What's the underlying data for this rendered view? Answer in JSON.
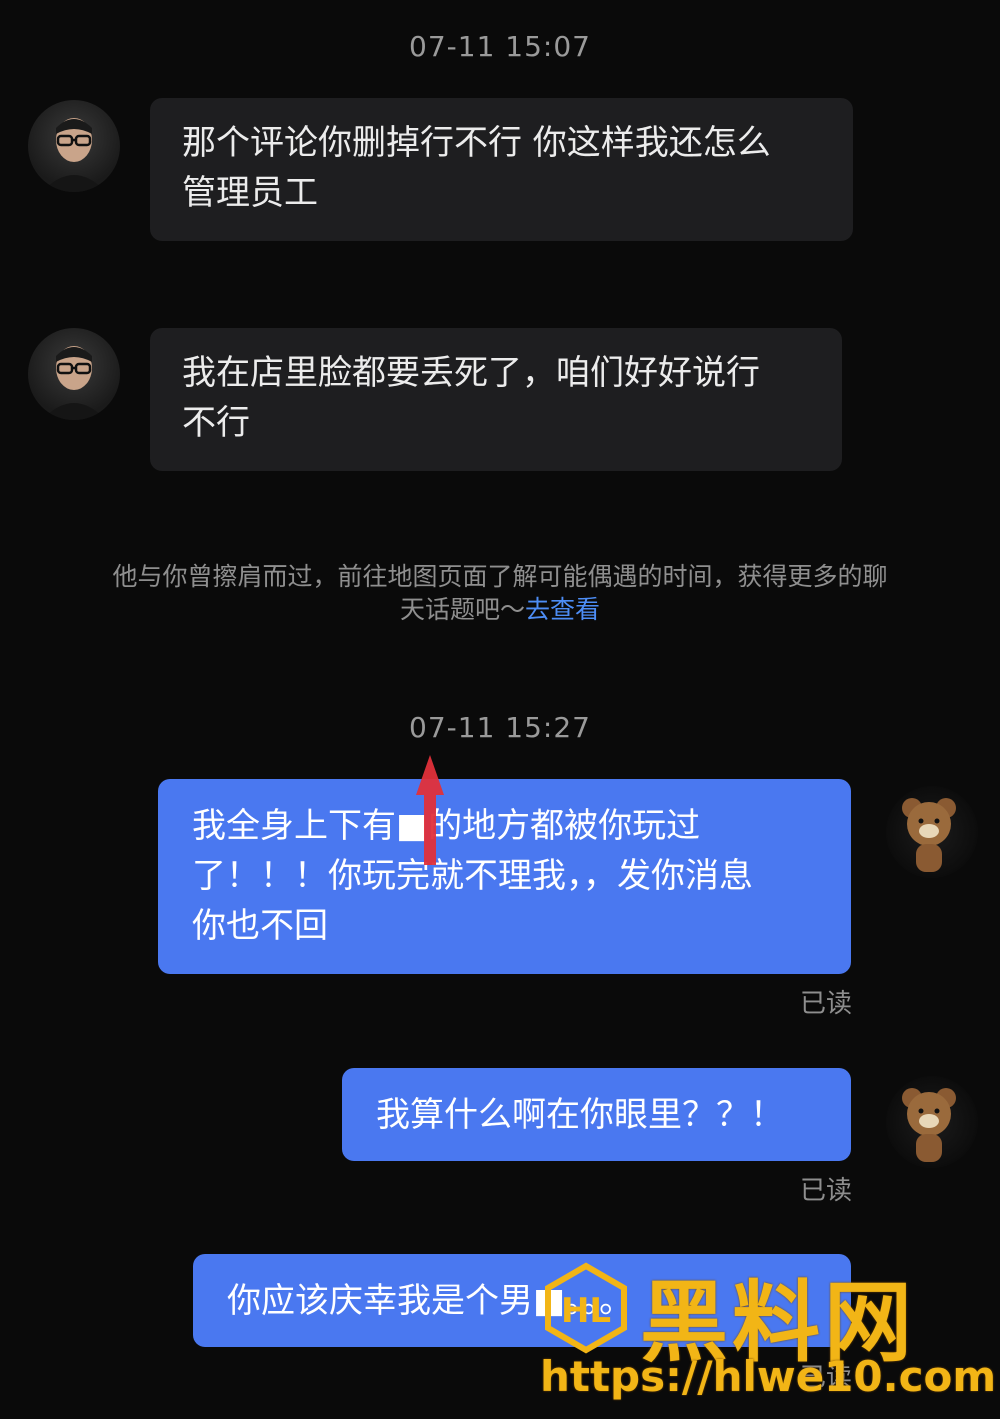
{
  "timestamps": [
    "07-11 15:07",
    "07-11 15:27"
  ],
  "messages_in": [
    "那个评论你删掉行不行 你这样我还怎么\n管理员工",
    "我在店里脸都要丢死了，咱们好好说行\n不行"
  ],
  "hint": {
    "text": "他与你曾擦肩而过，前往地图页面了解可能偶遇的时间，获得更多的聊天话题吧～",
    "link": "去查看"
  },
  "messages_out": [
    "我全身上下有■的地方都被你玩过\n了！！！你玩完就不理我，，发你消息\n你也不回",
    "我算什么啊在你眼里？？！",
    "你应该庆幸我是个男■。。。"
  ],
  "read_labels": [
    "已读",
    "已读",
    "已读"
  ],
  "watermark": {
    "brand": "黑料网",
    "url": "https://hlwe10.com"
  },
  "colors": {
    "background": "#0a0a0a",
    "incoming_bubble": "#1e1e20",
    "outgoing_bubble": "#4a78f0",
    "link": "#4d8df5",
    "watermark": "#f2b516"
  },
  "icons": {
    "incoming_avatar": "man-with-glasses-avatar",
    "outgoing_avatar": "teddy-bear-avatar",
    "marker": "red-arrow-marker"
  }
}
